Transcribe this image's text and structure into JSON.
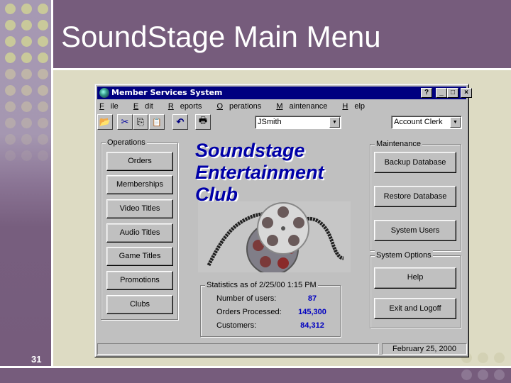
{
  "slide": {
    "title": "SoundStage Main Menu",
    "slide_number": "31",
    "colors": {
      "purple": "#765c7c",
      "cream": "#dddbc3",
      "dots": "#c9c99a"
    }
  },
  "window": {
    "title": "Member Services System",
    "title_buttons": {
      "help": "?",
      "minimize": "_",
      "maximize": "□",
      "close": "×"
    },
    "menu": [
      {
        "label": "File",
        "accel": "F"
      },
      {
        "label": "Edit",
        "accel": "E"
      },
      {
        "label": "Reports",
        "accel": "R"
      },
      {
        "label": "Operations",
        "accel": "O"
      },
      {
        "label": "Maintenance",
        "accel": "M"
      },
      {
        "label": "Help",
        "accel": "H"
      }
    ],
    "toolbar": [
      {
        "name": "open-icon",
        "glyph": "📂"
      },
      {
        "name": "cut-icon",
        "glyph": "✂"
      },
      {
        "name": "copy-icon",
        "glyph": "⎘"
      },
      {
        "name": "paste-icon",
        "glyph": "📋"
      },
      {
        "name": "undo-icon",
        "glyph": "↶"
      },
      {
        "name": "print-icon",
        "glyph": "🖶"
      }
    ],
    "user_combo": {
      "value": "JSmith"
    },
    "role_combo": {
      "value": "Account Clerk"
    },
    "combo_arrow": "▼",
    "logo": {
      "line1": "Soundstage",
      "line2": "Entertainment",
      "line3": "Club"
    },
    "operations": {
      "label": "Operations",
      "buttons": [
        "Orders",
        "Memberships",
        "Video Titles",
        "Audio Titles",
        "Game Titles",
        "Promotions",
        "Clubs"
      ]
    },
    "maintenance": {
      "label": "Maintenance",
      "buttons": [
        "Backup Database",
        "Restore Database",
        "System Users"
      ]
    },
    "system_options": {
      "label": "System Options",
      "buttons": [
        "Help",
        "Exit and Logoff"
      ]
    },
    "statistics": {
      "label": "Statistics as of 2/25/00 1:15 PM",
      "rows": [
        {
          "label": "Number of users:",
          "value": "87"
        },
        {
          "label": "Orders Processed:",
          "value": "145,300"
        },
        {
          "label": "Customers:",
          "value": "84,312"
        }
      ]
    },
    "status_bar": {
      "left": "",
      "date": "February 25, 2000"
    }
  }
}
